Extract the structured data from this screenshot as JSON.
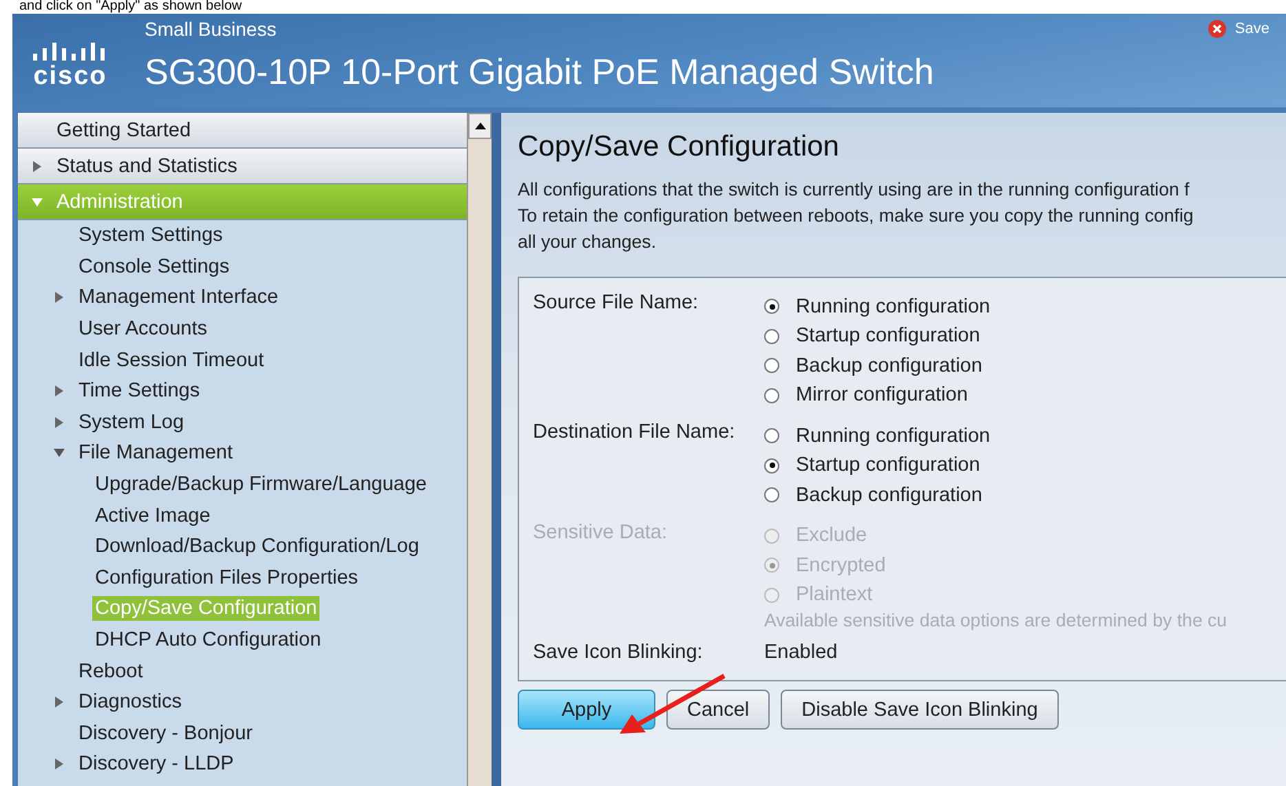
{
  "document_caption": "and click on \"Apply\" as shown below",
  "header": {
    "logo_text": "cisco",
    "subtitle": "Small Business",
    "title": "SG300-10P 10-Port Gigabit PoE Managed Switch",
    "save_label": "Save"
  },
  "sidebar": {
    "items": [
      {
        "label": "Getting Started",
        "kind": "page",
        "selected": false
      },
      {
        "label": "Status and Statistics",
        "kind": "folder",
        "expanded": false,
        "selected": false
      },
      {
        "label": "Administration",
        "kind": "folder",
        "expanded": true,
        "selected": true,
        "children": [
          {
            "label": "System Settings",
            "kind": "page",
            "selected": false
          },
          {
            "label": "Console Settings",
            "kind": "page",
            "selected": false
          },
          {
            "label": "Management Interface",
            "kind": "folder",
            "expanded": false,
            "selected": false
          },
          {
            "label": "User Accounts",
            "kind": "page",
            "selected": false
          },
          {
            "label": "Idle Session Timeout",
            "kind": "page",
            "selected": false
          },
          {
            "label": "Time Settings",
            "kind": "folder",
            "expanded": false,
            "selected": false
          },
          {
            "label": "System Log",
            "kind": "folder",
            "expanded": false,
            "selected": false
          },
          {
            "label": "File Management",
            "kind": "folder",
            "expanded": true,
            "selected": false,
            "children": [
              {
                "label": "Upgrade/Backup Firmware/Language",
                "kind": "page",
                "selected": false
              },
              {
                "label": "Active Image",
                "kind": "page",
                "selected": false
              },
              {
                "label": "Download/Backup Configuration/Log",
                "kind": "page",
                "selected": false
              },
              {
                "label": "Configuration Files Properties",
                "kind": "page",
                "selected": false
              },
              {
                "label": "Copy/Save Configuration",
                "kind": "page",
                "selected": true
              },
              {
                "label": "DHCP Auto Configuration",
                "kind": "page",
                "selected": false
              }
            ]
          },
          {
            "label": "Reboot",
            "kind": "page",
            "selected": false
          },
          {
            "label": "Diagnostics",
            "kind": "folder",
            "expanded": false,
            "selected": false
          },
          {
            "label": "Discovery - Bonjour",
            "kind": "page",
            "selected": false
          },
          {
            "label": "Discovery - LLDP",
            "kind": "folder",
            "expanded": false,
            "selected": false
          }
        ]
      }
    ]
  },
  "content": {
    "title": "Copy/Save Configuration",
    "description": [
      "All configurations that the switch is currently using are in the running configuration f",
      "To retain the configuration between reboots, make sure you copy the running config",
      "all your changes."
    ],
    "fields": [
      {
        "label": "Source File Name:",
        "kind": "radio",
        "disabled": false,
        "options": [
          {
            "label": "Running configuration",
            "selected": true
          },
          {
            "label": "Startup configuration",
            "selected": false
          },
          {
            "label": "Backup configuration",
            "selected": false
          },
          {
            "label": "Mirror configuration",
            "selected": false
          }
        ]
      },
      {
        "label": "Destination File Name:",
        "kind": "radio",
        "disabled": false,
        "options": [
          {
            "label": "Running configuration",
            "selected": false
          },
          {
            "label": "Startup configuration",
            "selected": true
          },
          {
            "label": "Backup configuration",
            "selected": false
          }
        ]
      },
      {
        "label": "Sensitive Data:",
        "kind": "radio",
        "disabled": true,
        "options": [
          {
            "label": "Exclude",
            "selected": false
          },
          {
            "label": "Encrypted",
            "selected": true
          },
          {
            "label": "Plaintext",
            "selected": false
          }
        ],
        "note": "Available sensitive data options are determined by the cu"
      },
      {
        "label": "Save Icon Blinking:",
        "kind": "text",
        "value": "Enabled"
      }
    ],
    "buttons": [
      {
        "label": "Apply",
        "kind": "primary"
      },
      {
        "label": "Cancel",
        "kind": "normal"
      },
      {
        "label": "Disable Save Icon Blinking",
        "kind": "normal"
      }
    ]
  }
}
